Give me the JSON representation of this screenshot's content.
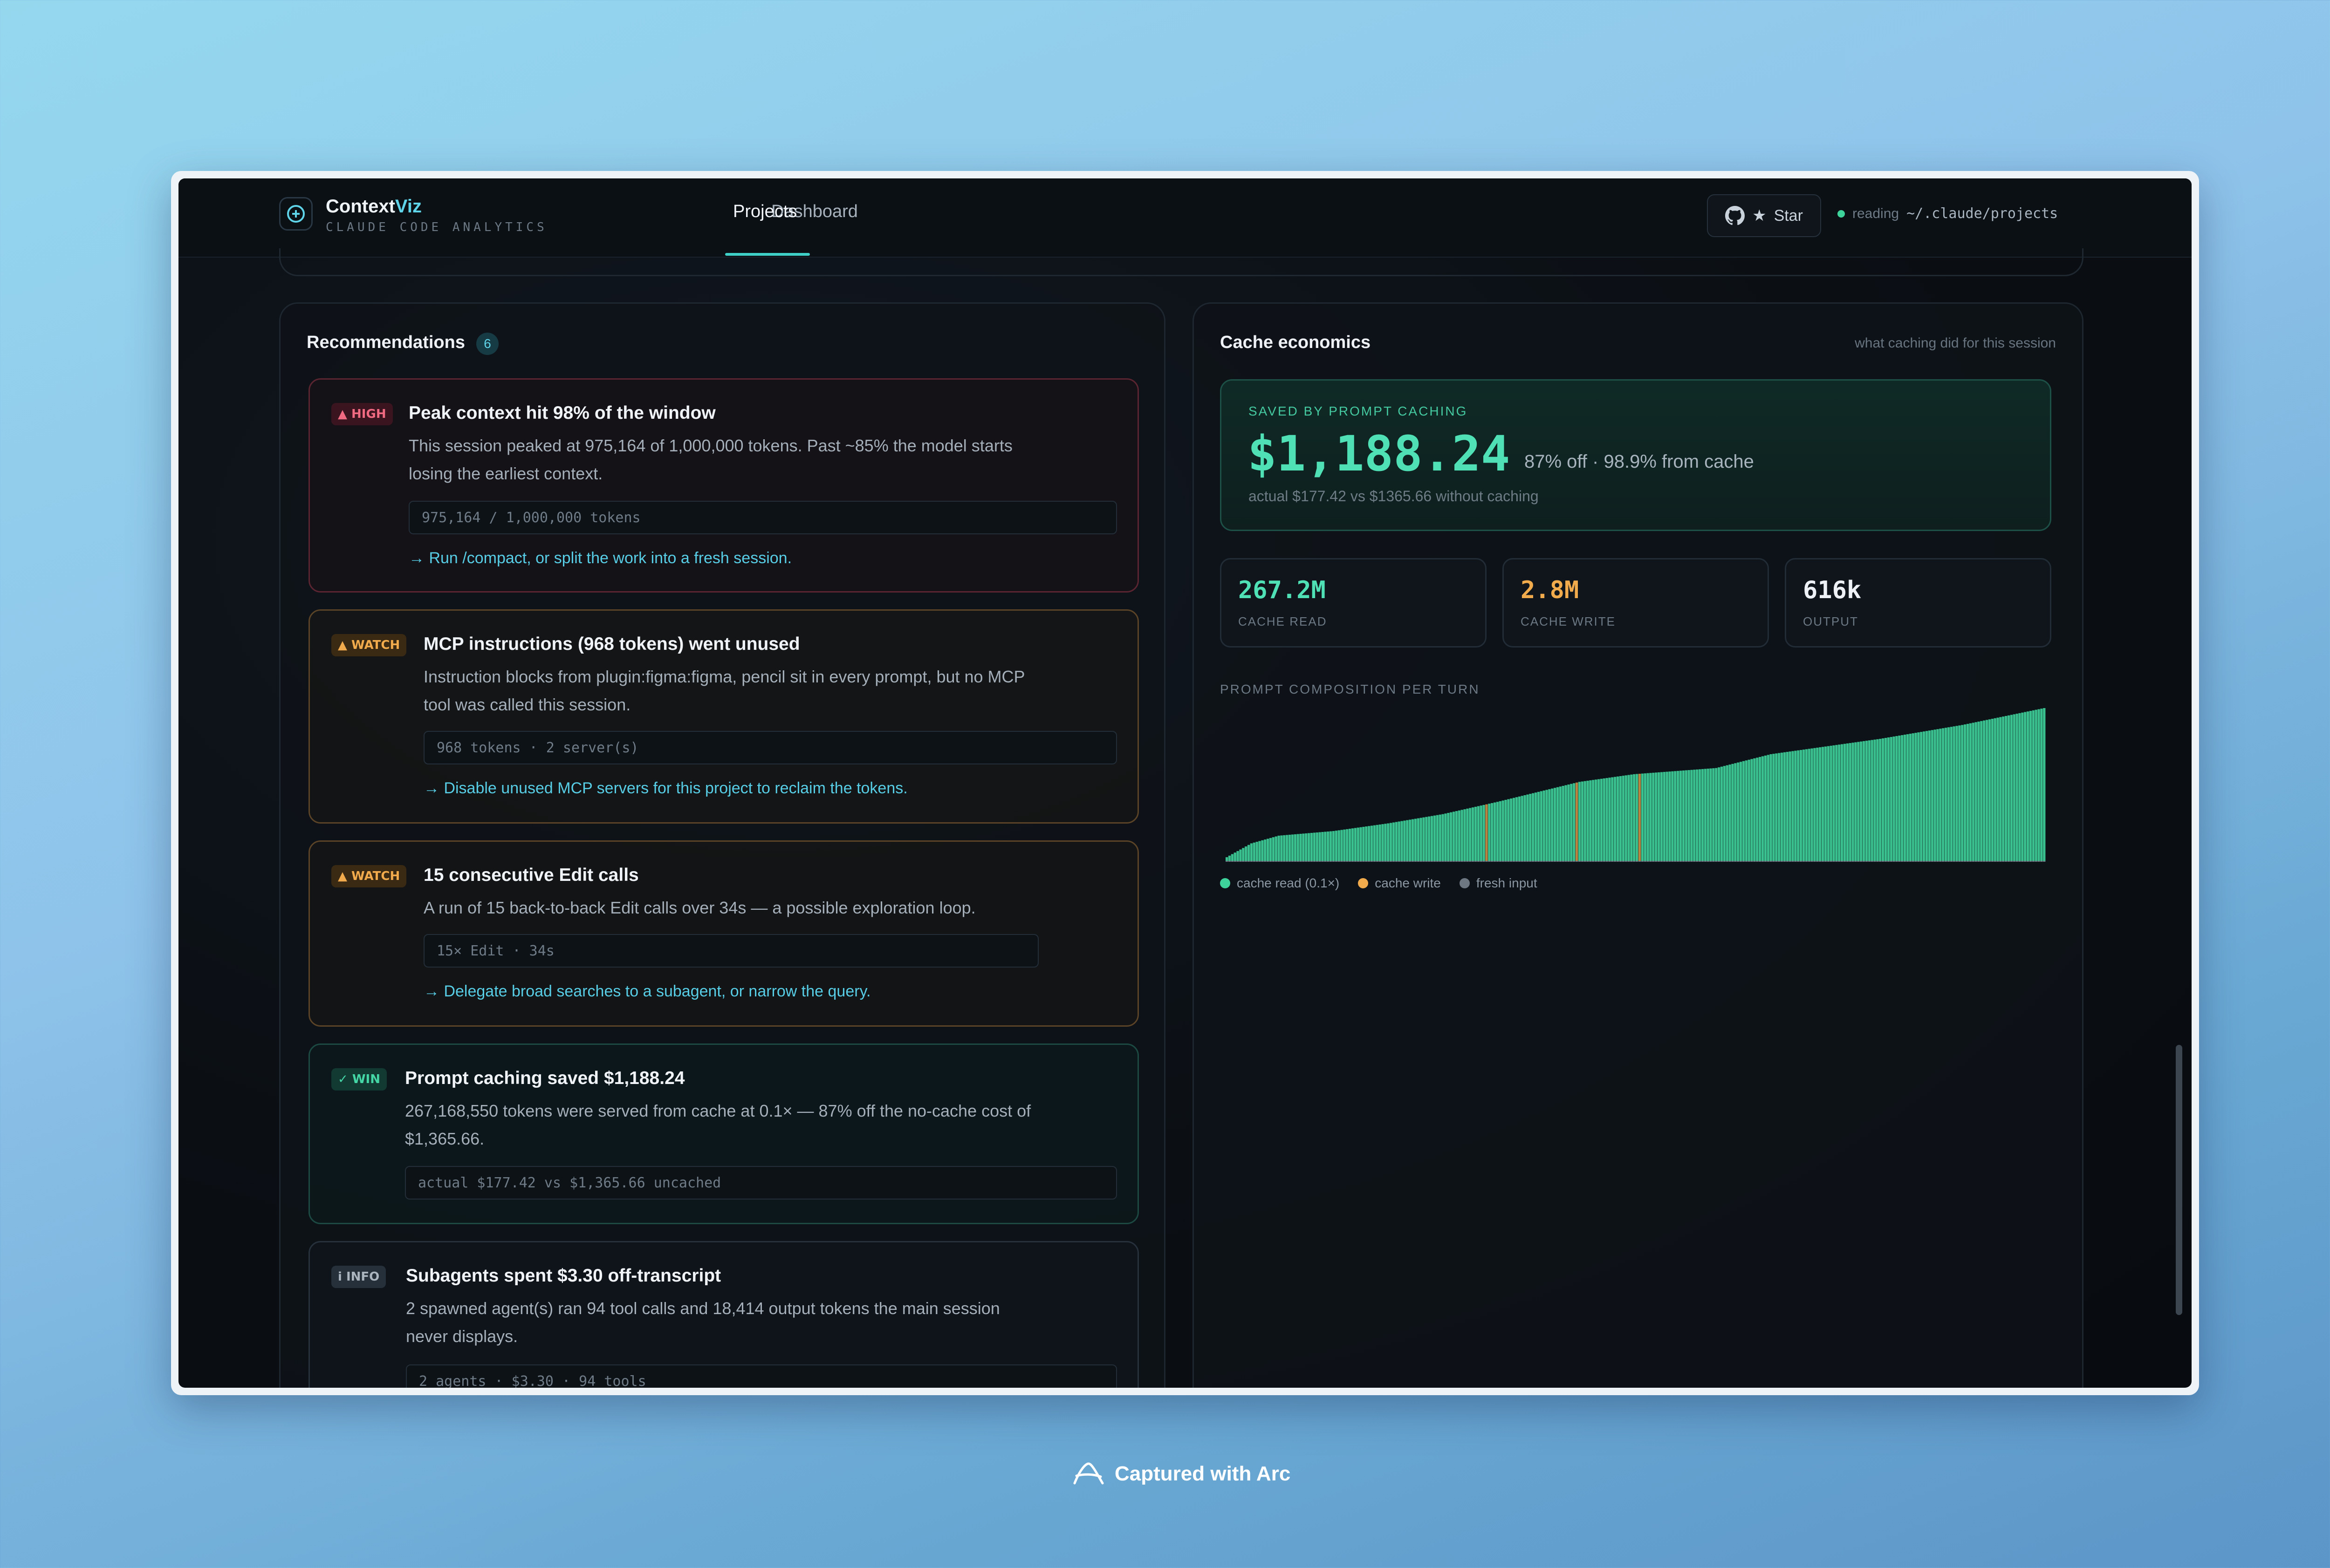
{
  "app": {
    "name_main": "Context",
    "name_accent": "Viz",
    "subtitle": "CLAUDE CODE ANALYTICS",
    "nav": [
      {
        "label": "Dashboard",
        "active": false
      },
      {
        "label": "Projects",
        "active": true
      }
    ],
    "star_label": "Star",
    "status_label": "reading",
    "status_path": "~/.claude/projects"
  },
  "recommendations": {
    "title": "Recommendations",
    "count": "6",
    "items": [
      {
        "severity": "high",
        "badge": "▲ HIGH",
        "title": "Peak context hit 98% of the window",
        "desc_lines": [
          "This session peaked at 975,164 of 1,000,000 tokens. Past ~85% the model starts",
          "losing the earliest context."
        ],
        "code": "975,164 / 1,000,000 tokens",
        "action": "→ Run /compact, or split the work into a fresh session."
      },
      {
        "severity": "watch",
        "badge": "▲ WATCH",
        "title": "MCP instructions (968 tokens) went unused",
        "desc_lines": [
          "Instruction blocks from plugin:figma:figma, pencil sit in every prompt, but no MCP",
          "tool was called this session."
        ],
        "code": "968 tokens · 2 server(s)",
        "action": "→ Disable unused MCP servers for this project to reclaim the tokens."
      },
      {
        "severity": "watch",
        "badge": "▲ WATCH",
        "title": "15 consecutive Edit calls",
        "desc_lines": [
          "A run of 15 back-to-back Edit calls over 34s — a possible exploration loop."
        ],
        "code": "15× Edit · 34s",
        "action": "→ Delegate broad searches to a subagent, or narrow the query."
      },
      {
        "severity": "win",
        "badge": "✓ WIN",
        "title": "Prompt caching saved $1,188.24",
        "desc_lines": [
          "267,168,550 tokens were served from cache at 0.1× — 87% off the no-cache cost of",
          "$1,365.66."
        ],
        "code": "actual $177.42 vs $1,365.66 uncached",
        "action": ""
      },
      {
        "severity": "info",
        "badge": "i INFO",
        "title": "Subagents spent $3.30 off-transcript",
        "desc_lines": [
          "2 spawned agent(s) ran 94 tool calls and 18,414 output tokens the main session",
          "never displays."
        ],
        "code": "2 agents · $3.30 · 94 tools",
        "action": ""
      }
    ]
  },
  "cache": {
    "title": "Cache economics",
    "subtitle": "what caching did for this session",
    "saved_label": "SAVED BY PROMPT CACHING",
    "saved_amount": "$1,188.24",
    "saved_pct": "87% off · 98.9% from cache",
    "saved_actual": "actual $177.42 vs $1365.66 without caching",
    "stats": [
      {
        "value": "267.2M",
        "label": "CACHE READ",
        "color": "#4fe0b6"
      },
      {
        "value": "2.8M",
        "label": "CACHE WRITE",
        "color": "#f2ab4c"
      },
      {
        "value": "616k",
        "label": "OUTPUT",
        "color": "#eef2f6"
      }
    ],
    "chart_title": "PROMPT COMPOSITION PER TURN",
    "legend": [
      {
        "label": "cache read (0.1×)",
        "color": "#3fd39c"
      },
      {
        "label": "cache write",
        "color": "#f2ab4c"
      },
      {
        "label": "fresh input",
        "color": "#6d7781"
      }
    ]
  },
  "chart_data": {
    "type": "bar",
    "title": "PROMPT COMPOSITION PER TURN",
    "series": [
      {
        "name": "cache read (0.1×)",
        "color": "#3fd39c"
      },
      {
        "name": "cache write",
        "color": "#f2ab4c"
      },
      {
        "name": "fresh input",
        "color": "#6d7781"
      }
    ],
    "n_turns": 300,
    "prompt_fraction_of_peak_at": [
      [
        0,
        0.02
      ],
      [
        10,
        0.12
      ],
      [
        20,
        0.17
      ],
      [
        40,
        0.2
      ],
      [
        60,
        0.25
      ],
      [
        80,
        0.31
      ],
      [
        100,
        0.39
      ],
      [
        130,
        0.52
      ],
      [
        150,
        0.57
      ],
      [
        180,
        0.61
      ],
      [
        200,
        0.7
      ],
      [
        240,
        0.8
      ],
      [
        270,
        0.89
      ],
      [
        300,
        1.0
      ]
    ],
    "write_spike_turns": [
      95,
      128,
      151
    ]
  },
  "footer": {
    "captured": "Captured with Arc"
  }
}
